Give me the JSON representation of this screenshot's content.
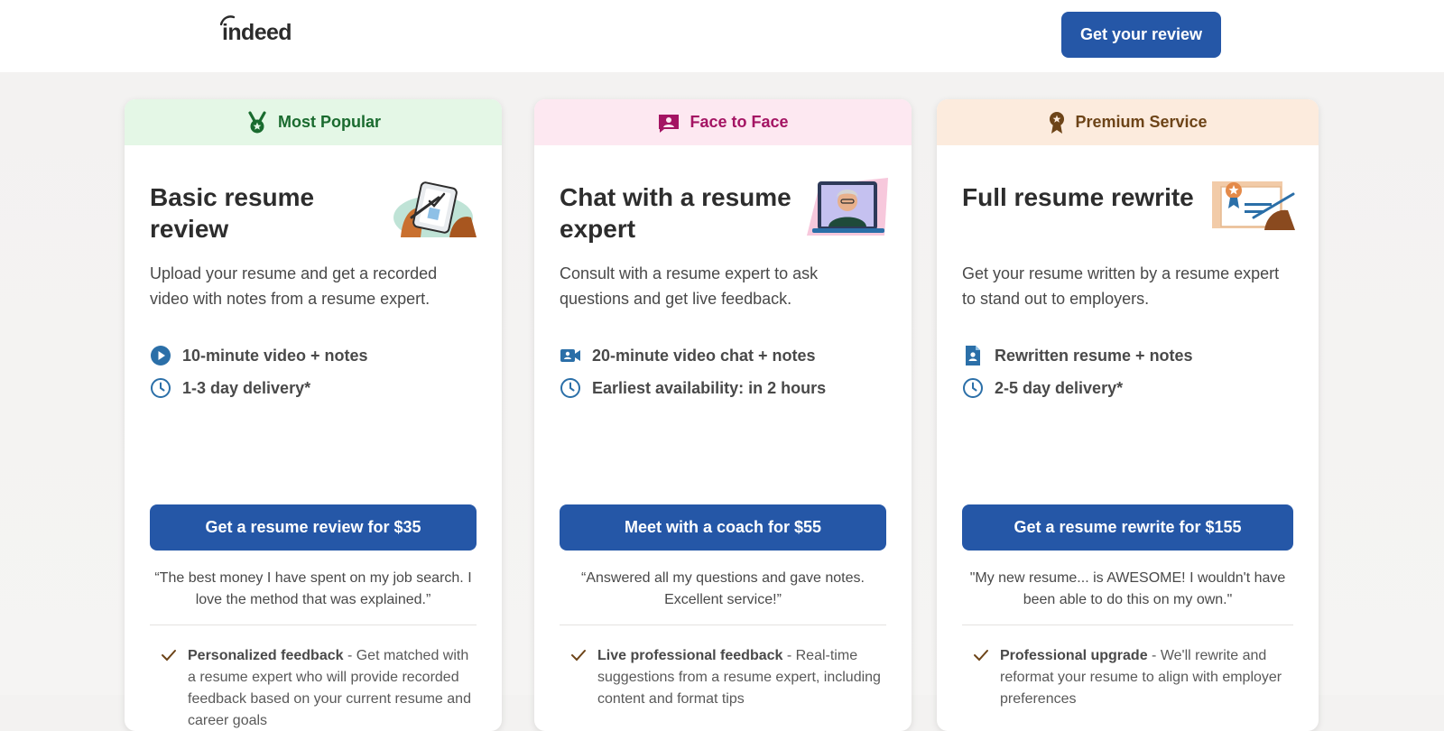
{
  "header": {
    "logo_text": "indeed",
    "cta_label": "Get your review"
  },
  "colors": {
    "primary": "#2557a7",
    "popular_bg": "#e4f7e6",
    "popular_text": "#1a6b2f",
    "face_bg": "#fde8f1",
    "face_text": "#a41463",
    "premium_bg": "#fcebdd",
    "premium_text": "#6d4418"
  },
  "cards": [
    {
      "badge_icon": "medal-icon",
      "badge": "Most Popular",
      "title": "Basic resume review",
      "illustration": "clipboard-illustration",
      "description": "Upload your resume and get a recorded video with notes from a resume expert.",
      "features": [
        {
          "icon": "play-circle-icon",
          "text": "10-minute video + notes"
        },
        {
          "icon": "clock-icon",
          "text": "1-3 day delivery*"
        }
      ],
      "cta": "Get a resume review for $35",
      "quote": "“The best money I have spent on my job search. I love the method that was explained.”",
      "benefit_title": "Personalized feedback",
      "benefit_text": " - Get matched with a resume expert who will provide recorded feedback based on your current resume and career goals"
    },
    {
      "badge_icon": "chat-person-icon",
      "badge": "Face to Face",
      "title": "Chat with a resume expert",
      "illustration": "video-call-illustration",
      "description": "Consult with a resume expert to ask questions and get live feedback.",
      "features": [
        {
          "icon": "video-camera-icon",
          "text": "20-minute video chat + notes"
        },
        {
          "icon": "clock-icon",
          "text": "Earliest availability: in 2 hours"
        }
      ],
      "cta": "Meet with a coach for $55",
      "quote": "“Answered all my questions and gave notes. Excellent service!”",
      "benefit_title": "Live professional feedback",
      "benefit_text": " - Real-time suggestions from a resume expert, including content and format tips"
    },
    {
      "badge_icon": "award-ribbon-icon",
      "badge": "Premium Service",
      "title": "Full resume rewrite",
      "illustration": "certificate-illustration",
      "description": "Get your resume written by a resume expert to stand out to employers.",
      "features": [
        {
          "icon": "resume-document-icon",
          "text": "Rewritten resume + notes"
        },
        {
          "icon": "clock-icon",
          "text": "2-5 day delivery*"
        }
      ],
      "cta": "Get a resume rewrite for $155",
      "quote": "\"My new resume... is AWESOME! I wouldn't have been able to do this on my own.\"",
      "benefit_title": "Professional upgrade",
      "benefit_text": " - We'll rewrite and reformat your resume to align with employer preferences"
    }
  ]
}
